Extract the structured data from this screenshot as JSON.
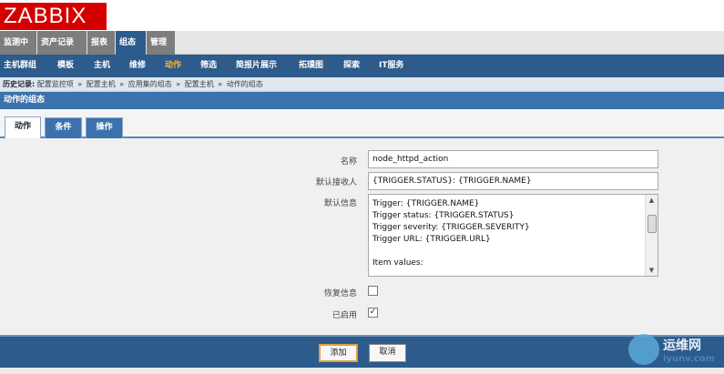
{
  "logo": "ZABBIX",
  "main_menu": [
    "监测中",
    "资产记录",
    "报表",
    "组态",
    "管理"
  ],
  "main_menu_active": "组态",
  "sub_menu": [
    "主机群组",
    "模板",
    "主机",
    "维修",
    "动作",
    "筛选",
    "简报片展示",
    "拓璞图",
    "探索",
    "IT服务"
  ],
  "sub_menu_active": "动作",
  "history": {
    "label": "历史记录:",
    "items": [
      "配置监控项",
      "配置主机",
      "应用集的组态",
      "配置主机",
      "动作的组态"
    ],
    "separator": "»"
  },
  "page_header": "动作的组态",
  "tabs": [
    "动作",
    "条件",
    "操作"
  ],
  "active_tab": "动作",
  "form": {
    "name_label": "名称",
    "name_value": "node_httpd_action",
    "recipient_label": "默认接收人",
    "recipient_value": "{TRIGGER.STATUS}: {TRIGGER.NAME}",
    "message_label": "默认信息",
    "message_lines": [
      "Trigger: {TRIGGER.NAME}",
      "Trigger status: {TRIGGER.STATUS}",
      "Trigger severity: {TRIGGER.SEVERITY}",
      "Trigger URL: {TRIGGER.URL}",
      "",
      "Item values:"
    ],
    "recovery_label": "恢复信息",
    "recovery_checked": false,
    "enabled_label": "已启用",
    "enabled_checked": true,
    "checkmark": "✓"
  },
  "buttons": {
    "add": "添加",
    "cancel": "取消"
  },
  "watermark": {
    "cn": "运维网",
    "url": "iyunv.com"
  },
  "colors": {
    "brand_red": "#d40000",
    "nav_blue": "#2c5b8c",
    "active_orange": "#f6b73c"
  }
}
